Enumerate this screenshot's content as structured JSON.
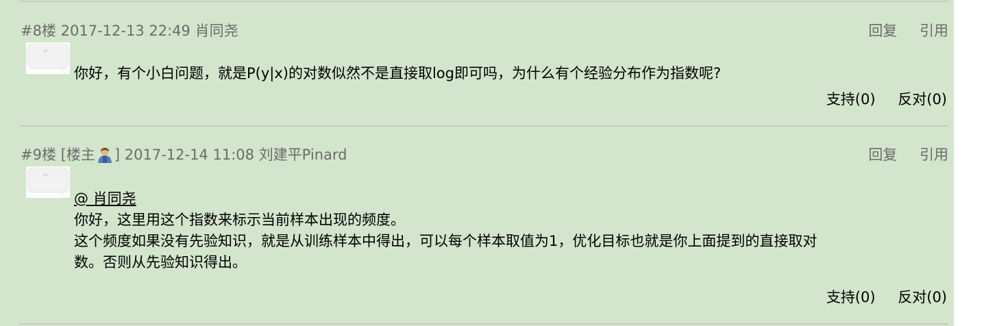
{
  "comments": [
    {
      "floor": "#8楼",
      "owner_tag": "",
      "timestamp": "2017-12-13 22:49",
      "author": "肖同尧",
      "reply_label": "回复",
      "quote_label": "引用",
      "lines": [
        "你好，有个小白问题，就是P(y|x)的对数似然不是直接取log即可吗，为什么有个经验分布作为指数呢?"
      ],
      "support_label": "支持(0)",
      "oppose_label": "反对(0)"
    },
    {
      "floor": "#9楼",
      "owner_tag_open": "[楼主",
      "owner_tag_close": "]",
      "timestamp": "2017-12-14 11:08",
      "author": "刘建平Pinard",
      "reply_label": "回复",
      "quote_label": "引用",
      "mention": "@ 肖同尧",
      "lines": [
        "你好，这里用这个指数来标示当前样本出现的频度。",
        "这个频度如果没有先验知识，就是从训练样本中得出，可以每个样本取值为1，优化目标也就是你上面提到的直接取对",
        "数。否则从先验知识得出。"
      ],
      "support_label": "支持(0)",
      "oppose_label": "反对(0)"
    }
  ],
  "colors": {
    "background": "#d3e5cc",
    "meta_text": "#6b6b6b",
    "divider": "#c3cdbf"
  },
  "icons": {
    "quote": "quote-bubble-icon",
    "owner_avatar": "user-avatar-icon"
  }
}
